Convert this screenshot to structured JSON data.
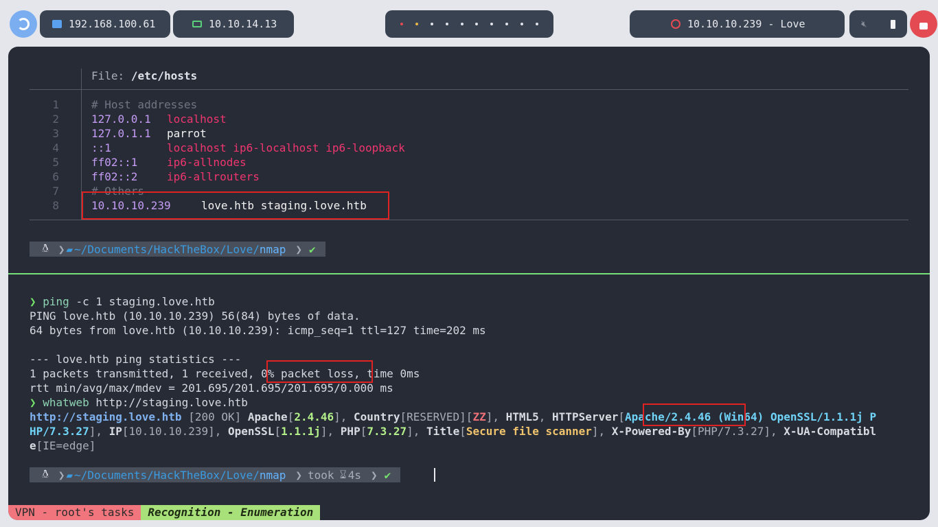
{
  "topbar": {
    "ip_local": "192.168.100.61",
    "ip_vpn": "10.10.14.13",
    "target": "10.10.10.239 - Love",
    "workspace_count": 10
  },
  "hosts_view": {
    "header_label": "File:",
    "filename": "/etc/hosts",
    "lines": [
      {
        "n": "1",
        "ip": "",
        "host": "",
        "comment": "# Host addresses"
      },
      {
        "n": "2",
        "ip": "127.0.0.1",
        "host": "localhost"
      },
      {
        "n": "3",
        "ip": "127.0.1.1",
        "host": "parrot"
      },
      {
        "n": "4",
        "ip": "::1",
        "host": "localhost ip6-localhost ip6-loopback"
      },
      {
        "n": "5",
        "ip": "ff02::1",
        "host": "ip6-allnodes"
      },
      {
        "n": "6",
        "ip": "ff02::2",
        "host": "ip6-allrouters"
      },
      {
        "n": "7",
        "ip": "",
        "host": "",
        "comment": "# Others"
      },
      {
        "n": "8",
        "ip": "10.10.10.239",
        "host": "love.htb staging.love.htb"
      }
    ]
  },
  "prompt": {
    "path_prefix": "~/Documents/HackTheBox/Love/",
    "path_last": "nmap",
    "check": "✔",
    "took_label": "took",
    "took_value": "4s"
  },
  "session": {
    "prompt_symbol": "❯",
    "cmd1": "ping",
    "cmd1_args": " -c 1 staging.love.htb",
    "out1": "PING love.htb (10.10.10.239) 56(84) bytes of data.",
    "out2": "64 bytes from love.htb (10.10.10.239): icmp_seq=1 ttl=127 time=202 ms",
    "out3": "--- love.htb ping statistics ---",
    "out4a": "1 packets transmitted, 1 received, ",
    "out4b": "0% packet loss",
    "out4c": ", time 0ms",
    "out5": "rtt min/avg/max/mdev = 201.695/201.695/201.695/0.000 ms",
    "cmd2": "whatweb",
    "cmd2_args": " http://staging.love.htb",
    "ww_url": "http://staging.love.htb",
    "ww_status": " [200 OK] ",
    "ww_apache_label": "Apache",
    "ww_apache_ver": "2.4.46",
    "ww_country_label": "Country",
    "ww_country_val": "RESERVED",
    "ww_country_code": "ZZ",
    "ww_html5": "HTML5",
    "ww_httpserver_label": "HTTPServer",
    "ww_httpserver_hl": "Apache/2.4.46",
    "ww_httpserver_rest": " (Win64) OpenSSL/1.1.1j P",
    "ww_l2_start": "HP/7.3.27",
    "ww_ip_label": "IP",
    "ww_ip_val": "10.10.10.239",
    "ww_openssl_label": "OpenSSL",
    "ww_openssl_val": "1.1.1j",
    "ww_php_label": "PHP",
    "ww_php_val": "7.3.27",
    "ww_title_label": "Title",
    "ww_title_val": "Secure file scanner",
    "ww_xpb_label": "X-Powered-By",
    "ww_xpb_val": "PHP/7.3.27",
    "ww_xua_label": "X-UA-Compatibl",
    "ww_l3": "e",
    "ww_xua_val": "IE=edge"
  },
  "statusbar": {
    "session_name": "VPN - root's tasks",
    "window_name": "Recognition - Enumeration"
  },
  "colors": {
    "accent_green": "#76e07a",
    "highlight_box": "#e02222",
    "host_pink": "#f0356f",
    "ip_purple": "#c59cf6"
  }
}
